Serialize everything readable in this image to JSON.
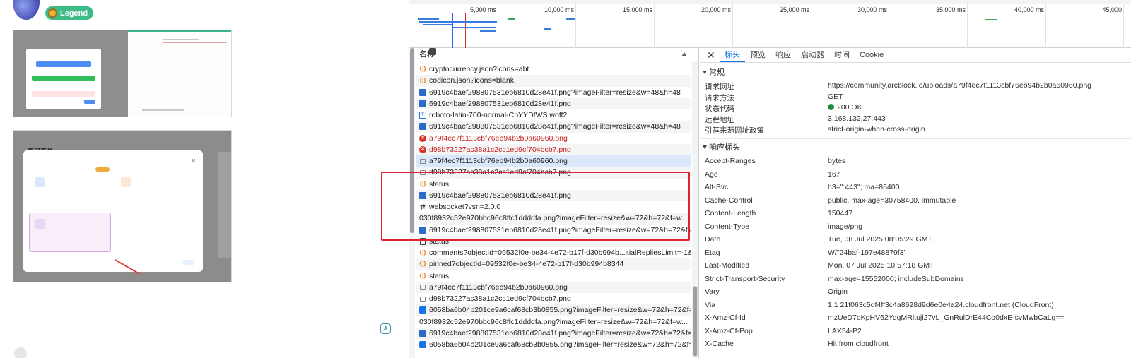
{
  "post": {
    "badge_label": "Legend",
    "thumb2_title": "实用工具"
  },
  "timeline": {
    "ticks": [
      "5,000 ms",
      "10,000 ms",
      "15,000 ms",
      "20,000 ms",
      "25,000 ms",
      "30,000 ms",
      "35,000 ms",
      "40,000 ms",
      "45,000"
    ]
  },
  "request_list": {
    "header": "名称",
    "rows": [
      {
        "name": "cryptocurrency.json?icons=abt",
        "icon": "json-icon",
        "state": "normal"
      },
      {
        "name": "codicon.json?icons=blank",
        "icon": "json-icon",
        "state": "normal"
      },
      {
        "name": "6919c4baef298807531eb6810d28e41f.png?imageFilter=resize&w=48&h=48",
        "icon": "png-icon",
        "state": "normal"
      },
      {
        "name": "6919c4baef298807531eb6810d28e41f.png",
        "icon": "png-icon",
        "state": "normal"
      },
      {
        "name": "roboto-latin-700-normal-CbYYDfWS.woff2",
        "icon": "font-icon",
        "state": "normal"
      },
      {
        "name": "6919c4baef298807531eb6810d28e41f.png?imageFilter=resize&w=48&h=48",
        "icon": "png-icon",
        "state": "normal"
      },
      {
        "name": "a79f4ec7f1113cbf76eb94b2b0a60960.png",
        "icon": "error-icon",
        "state": "error"
      },
      {
        "name": "d98b73227ac38a1c2cc1ed9cf704bcb7.png",
        "icon": "error-icon",
        "state": "error"
      },
      {
        "name": "a79f4ec7f1113cbf76eb94b2b0a60960.png",
        "icon": "image-icon",
        "state": "selected"
      },
      {
        "name": "d98b73227ac38a1c2cc1ed9cf704bcb7.png",
        "icon": "image-icon",
        "state": "normal"
      },
      {
        "name": "status",
        "icon": "json-icon",
        "state": "normal"
      },
      {
        "name": "6919c4baef298807531eb6810d28e41f.png",
        "icon": "png-icon",
        "state": "normal"
      },
      {
        "name": "websocket?vsn=2.0.0",
        "icon": "websocket-icon",
        "state": "normal"
      },
      {
        "name": "030f8932c52e970bbc96c8ffc1ddddfa.png?imageFilter=resize&w=72&h=72&f=w...",
        "icon": "avatar-icon",
        "state": "normal"
      },
      {
        "name": "6919c4baef298807531eb6810d28e41f.png?imageFilter=resize&w=72&h=72&f=...",
        "icon": "png-icon",
        "state": "normal"
      },
      {
        "name": "status",
        "icon": "document-icon",
        "state": "normal"
      },
      {
        "name": "comments?objectId=09532f0e-be34-4e72-b17f-d30b994b...itialRepliesLimit=-1&...",
        "icon": "json-icon",
        "state": "normal"
      },
      {
        "name": "pinned?objectId=09532f0e-be34-4e72-b17f-d30b994b8344",
        "icon": "json-icon",
        "state": "normal"
      },
      {
        "name": "status",
        "icon": "json-icon",
        "state": "normal"
      },
      {
        "name": "a79f4ec7f1113cbf76eb94b2b0a60960.png",
        "icon": "image-icon",
        "state": "normal"
      },
      {
        "name": "d98b73227ac38a1c2cc1ed9cf704bcb7.png",
        "icon": "image-icon",
        "state": "normal"
      },
      {
        "name": "6058ba6b04b201ce9a6caf68cb3b0855.png?imageFilter=resize&w=72&h=72&f=...",
        "icon": "circle-avatar-icon",
        "state": "normal"
      },
      {
        "name": "030f8932c52e970bbc96c8ffc1ddddfa.png?imageFilter=resize&w=72&h=72&f=w...",
        "icon": "avatar-icon",
        "state": "normal"
      },
      {
        "name": "6919c4baef298807531eb6810d28e41f.png?imageFilter=resize&w=72&h=72&f=...",
        "icon": "png-icon",
        "state": "normal"
      },
      {
        "name": "6058ba6b04b201ce9a6caf68cb3b0855.png?imageFilter=resize&w=72&h=72&f=...",
        "icon": "circle-avatar-icon",
        "state": "normal"
      }
    ]
  },
  "details": {
    "tabs": [
      "标头",
      "预览",
      "响应",
      "启动器",
      "时间",
      "Cookie"
    ],
    "active_tab": "标头",
    "general": {
      "title": "常规",
      "rows": [
        {
          "k": "请求网址",
          "v": "https://community.arcblock.io/uploads/a79f4ec7f1113cbf76eb94b2b0a60960.png"
        },
        {
          "k": "请求方法",
          "v": "GET"
        },
        {
          "k": "状态代码",
          "v": "200 OK"
        },
        {
          "k": "远程地址",
          "v": "3.168.132.27:443"
        },
        {
          "k": "引荐来源网址政策",
          "v": "strict-origin-when-cross-origin"
        }
      ]
    },
    "response": {
      "title": "响应标头",
      "rows": [
        {
          "k": "Accept-Ranges",
          "v": "bytes"
        },
        {
          "k": "Age",
          "v": "167"
        },
        {
          "k": "Alt-Svc",
          "v": "h3=\":443\"; ma=86400"
        },
        {
          "k": "Cache-Control",
          "v": "public, max-age=30758400, immutable"
        },
        {
          "k": "Content-Length",
          "v": "150447"
        },
        {
          "k": "Content-Type",
          "v": "image/png"
        },
        {
          "k": "Date",
          "v": "Tue, 08 Jul 2025 08:05:29 GMT"
        },
        {
          "k": "Etag",
          "v": "W/\"24baf-197e48879f3\""
        },
        {
          "k": "Last-Modified",
          "v": "Mon, 07 Jul 2025 10:57:18 GMT"
        },
        {
          "k": "Strict-Transport-Security",
          "v": "max-age=15552000; includeSubDomains"
        },
        {
          "k": "Vary",
          "v": "Origin"
        },
        {
          "k": "Via",
          "v": "1.1 21f063c5df4ff3c4a8628d9d6e0e4a24.cloudfront.net (CloudFront)"
        },
        {
          "k": "X-Amz-Cf-Id",
          "v": "mzUeD7oKpHV62YqgMRltujl27vL_GnRulDrE44Co0dxE-svMwbCaLg=="
        },
        {
          "k": "X-Amz-Cf-Pop",
          "v": "LAX54-P2"
        },
        {
          "k": "X-Cache",
          "v": "Hit from cloudfront"
        }
      ]
    }
  }
}
